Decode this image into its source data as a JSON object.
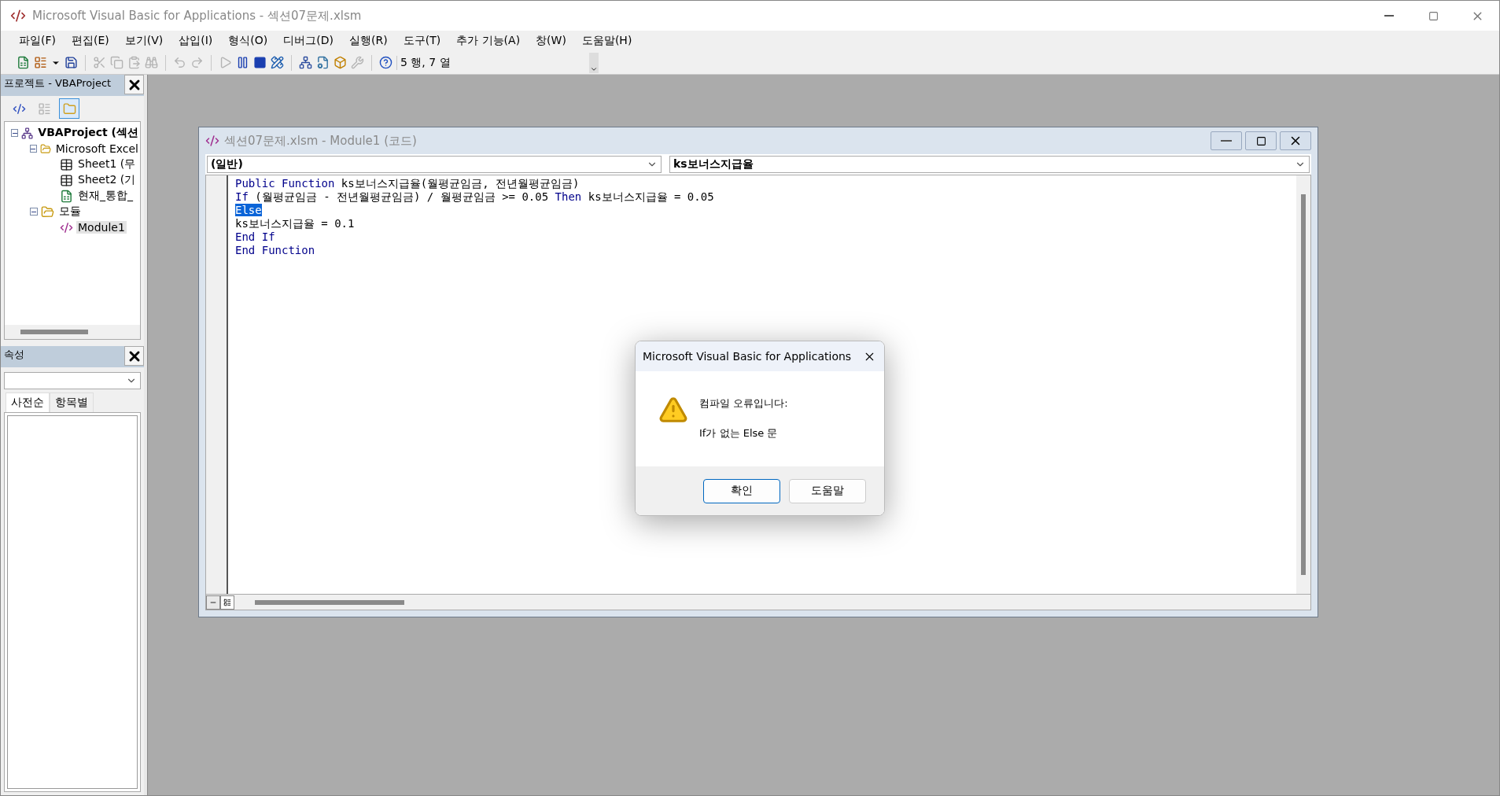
{
  "window": {
    "title": "Microsoft Visual Basic for Applications - 섹션07문제.xlsm"
  },
  "menu": [
    "파일(F)",
    "편집(E)",
    "보기(V)",
    "삽입(I)",
    "형식(O)",
    "디버그(D)",
    "실행(R)",
    "도구(T)",
    "추가 기능(A)",
    "창(W)",
    "도움말(H)"
  ],
  "toolbar": [
    {
      "kind": "excel",
      "disabled": false
    },
    {
      "kind": "userform",
      "disabled": false
    },
    {
      "kind": "dropdown",
      "disabled": false
    },
    {
      "kind": "save",
      "disabled": false
    },
    {
      "kind": "separator"
    },
    {
      "kind": "cut",
      "disabled": true
    },
    {
      "kind": "copy",
      "disabled": true
    },
    {
      "kind": "paste",
      "disabled": true
    },
    {
      "kind": "find",
      "disabled": true
    },
    {
      "kind": "separator"
    },
    {
      "kind": "undo",
      "disabled": true
    },
    {
      "kind": "redo",
      "disabled": true
    },
    {
      "kind": "separator"
    },
    {
      "kind": "run",
      "disabled": true
    },
    {
      "kind": "pause",
      "disabled": false
    },
    {
      "kind": "reset",
      "disabled": false
    },
    {
      "kind": "design",
      "disabled": false
    },
    {
      "kind": "separator"
    },
    {
      "kind": "explorer",
      "disabled": false
    },
    {
      "kind": "properties",
      "disabled": false
    },
    {
      "kind": "browser",
      "disabled": false
    },
    {
      "kind": "toolbox",
      "disabled": true
    },
    {
      "kind": "separator"
    },
    {
      "kind": "help",
      "disabled": false
    }
  ],
  "cursor_position": "5 행, 7 열",
  "project_pane": {
    "title": "프로젝트 - VBAProject",
    "tools": [
      {
        "kind": "code",
        "disabled": false,
        "pressed": false
      },
      {
        "kind": "object",
        "disabled": true,
        "pressed": false
      },
      {
        "kind": "folders",
        "disabled": false,
        "pressed": true
      }
    ],
    "tree": [
      {
        "label": "VBAProject (섹션",
        "kind": "project",
        "expanded": true,
        "selected": false,
        "children": [
          {
            "label": "Microsoft Excel",
            "kind": "folder",
            "expanded": true,
            "selected": false,
            "children": [
              {
                "label": "Sheet1 (무",
                "kind": "sheet",
                "selected": false
              },
              {
                "label": "Sheet2 (기",
                "kind": "sheet",
                "selected": false
              },
              {
                "label": "현재_통합_",
                "kind": "workbook",
                "selected": false
              }
            ]
          },
          {
            "label": "모듈",
            "kind": "folder",
            "expanded": true,
            "selected": false,
            "children": [
              {
                "label": "Module1",
                "kind": "module",
                "selected": true
              }
            ]
          }
        ]
      }
    ]
  },
  "properties_pane": {
    "title": "속성",
    "tabs": [
      {
        "label": "사전순",
        "selected": true
      },
      {
        "label": "항목별",
        "selected": false
      }
    ]
  },
  "code_window": {
    "title": "섹션07문제.xlsm - Module1 (코드)",
    "object_combo": "(일반)",
    "procedure_combo": "ks보너스지급율",
    "lines": [
      [
        {
          "text": "Public Function",
          "kind": "keyword"
        },
        {
          "text": " ks보너스지급율(월평균임금, 전년월평균임금)",
          "kind": "plain"
        }
      ],
      [
        {
          "text": "If",
          "kind": "keyword"
        },
        {
          "text": " (월평균임금 - 전년월평균임금) / 월평균임금 >= 0.05 ",
          "kind": "plain"
        },
        {
          "text": "Then",
          "kind": "keyword"
        },
        {
          "text": " ks보너스지급율 = 0.05",
          "kind": "plain"
        }
      ],
      [
        {
          "text": "Else",
          "kind": "selected"
        }
      ],
      [
        {
          "text": "ks보너스지급율 = 0.1",
          "kind": "plain"
        }
      ],
      [
        {
          "text": "End If",
          "kind": "keyword"
        }
      ],
      [
        {
          "text": "End Function",
          "kind": "keyword"
        }
      ]
    ]
  },
  "dialog": {
    "title": "Microsoft Visual Basic for Applications",
    "message": "컴파일 오류입니다:",
    "detail": "If가 없는 Else 문",
    "buttons": [
      {
        "label": "확인",
        "default": true
      },
      {
        "label": "도움말",
        "default": false
      }
    ]
  }
}
